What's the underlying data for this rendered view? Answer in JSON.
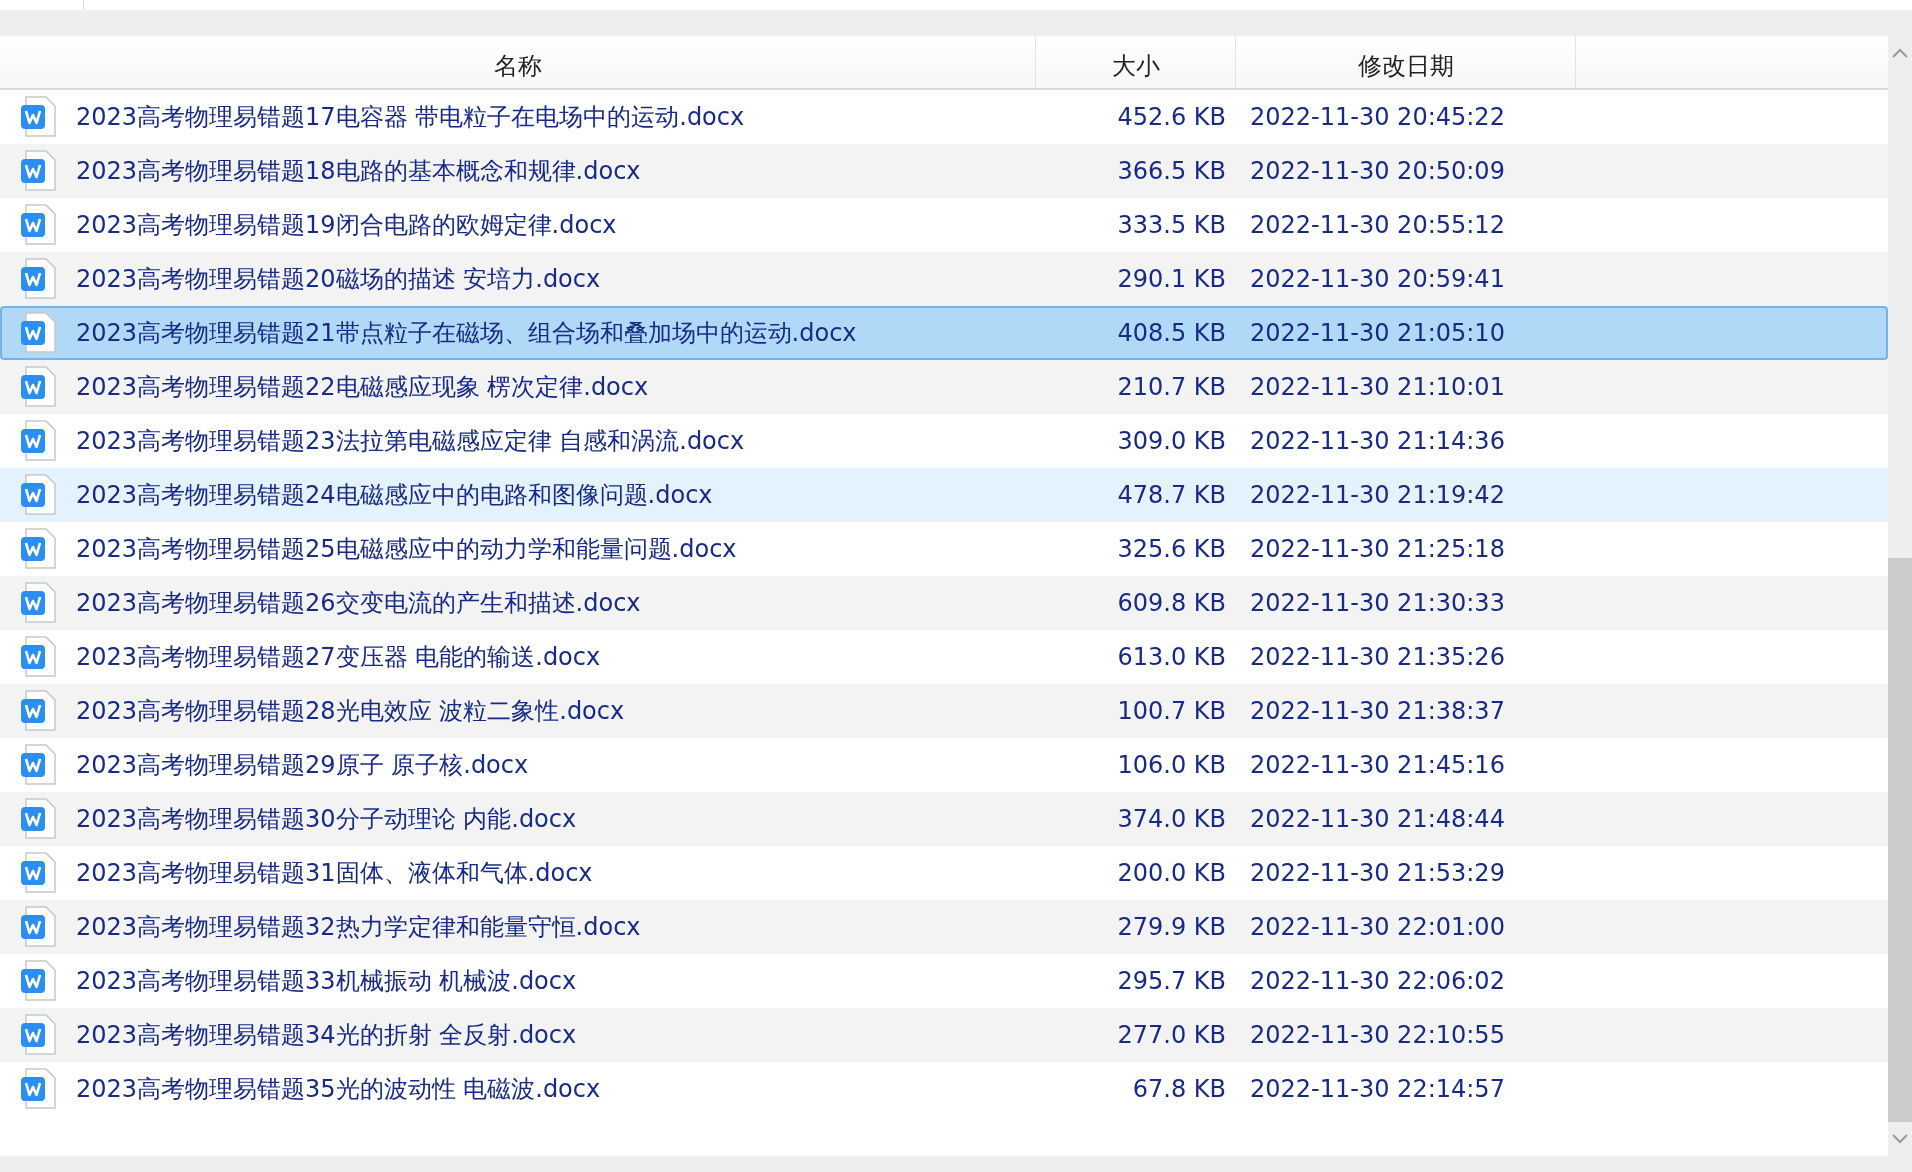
{
  "columns": [
    "名称",
    "大小",
    "修改日期"
  ],
  "rows": [
    {
      "name": "2023高考物理易错题17电容器 带电粒子在电场中的运动.docx",
      "size": "452.6 KB",
      "date": "2022-11-30 20:45:22",
      "selected": false,
      "hovered": false
    },
    {
      "name": "2023高考物理易错题18电路的基本概念和规律.docx",
      "size": "366.5 KB",
      "date": "2022-11-30 20:50:09",
      "selected": false,
      "hovered": false
    },
    {
      "name": "2023高考物理易错题19闭合电路的欧姆定律.docx",
      "size": "333.5 KB",
      "date": "2022-11-30 20:55:12",
      "selected": false,
      "hovered": false
    },
    {
      "name": "2023高考物理易错题20磁场的描述 安培力.docx",
      "size": "290.1 KB",
      "date": "2022-11-30 20:59:41",
      "selected": false,
      "hovered": false
    },
    {
      "name": "2023高考物理易错题21带点粒子在磁场、组合场和叠加场中的运动.docx",
      "size": "408.5 KB",
      "date": "2022-11-30 21:05:10",
      "selected": true,
      "hovered": false
    },
    {
      "name": "2023高考物理易错题22电磁感应现象 楞次定律.docx",
      "size": "210.7 KB",
      "date": "2022-11-30 21:10:01",
      "selected": false,
      "hovered": false
    },
    {
      "name": "2023高考物理易错题23法拉第电磁感应定律 自感和涡流.docx",
      "size": "309.0 KB",
      "date": "2022-11-30 21:14:36",
      "selected": false,
      "hovered": false
    },
    {
      "name": "2023高考物理易错题24电磁感应中的电路和图像问题.docx",
      "size": "478.7 KB",
      "date": "2022-11-30 21:19:42",
      "selected": false,
      "hovered": true
    },
    {
      "name": "2023高考物理易错题25电磁感应中的动力学和能量问题.docx",
      "size": "325.6 KB",
      "date": "2022-11-30 21:25:18",
      "selected": false,
      "hovered": false
    },
    {
      "name": "2023高考物理易错题26交变电流的产生和描述.docx",
      "size": "609.8 KB",
      "date": "2022-11-30 21:30:33",
      "selected": false,
      "hovered": false
    },
    {
      "name": "2023高考物理易错题27变压器 电能的输送.docx",
      "size": "613.0 KB",
      "date": "2022-11-30 21:35:26",
      "selected": false,
      "hovered": false
    },
    {
      "name": "2023高考物理易错题28光电效应 波粒二象性.docx",
      "size": "100.7 KB",
      "date": "2022-11-30 21:38:37",
      "selected": false,
      "hovered": false
    },
    {
      "name": "2023高考物理易错题29原子 原子核.docx",
      "size": "106.0 KB",
      "date": "2022-11-30 21:45:16",
      "selected": false,
      "hovered": false
    },
    {
      "name": "2023高考物理易错题30分子动理论 内能.docx",
      "size": "374.0 KB",
      "date": "2022-11-30 21:48:44",
      "selected": false,
      "hovered": false
    },
    {
      "name": "2023高考物理易错题31固体、液体和气体.docx",
      "size": "200.0 KB",
      "date": "2022-11-30 21:53:29",
      "selected": false,
      "hovered": false
    },
    {
      "name": "2023高考物理易错题32热力学定律和能量守恒.docx",
      "size": "279.9 KB",
      "date": "2022-11-30 22:01:00",
      "selected": false,
      "hovered": false
    },
    {
      "name": "2023高考物理易错题33机械振动 机械波.docx",
      "size": "295.7 KB",
      "date": "2022-11-30 22:06:02",
      "selected": false,
      "hovered": false
    },
    {
      "name": "2023高考物理易错题34光的折射 全反射.docx",
      "size": "277.0 KB",
      "date": "2022-11-30 22:10:55",
      "selected": false,
      "hovered": false
    },
    {
      "name": "2023高考物理易错题35光的波动性 电磁波.docx",
      "size": "67.8 KB",
      "date": "2022-11-30 22:14:57",
      "selected": false,
      "hovered": false
    }
  ]
}
